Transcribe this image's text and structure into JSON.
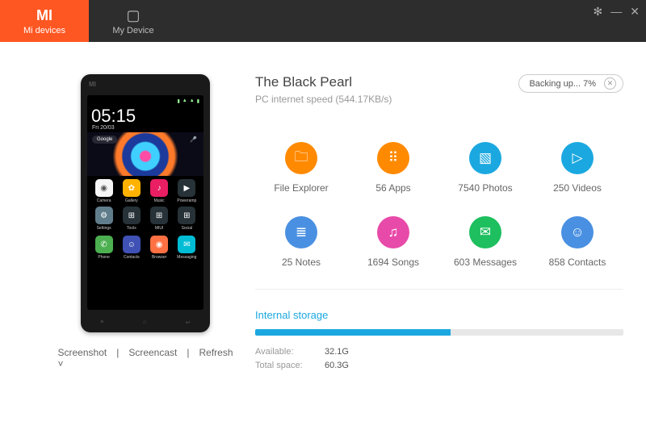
{
  "header": {
    "tabs": [
      {
        "label": "Mi devices",
        "icon": "MI"
      },
      {
        "label": "My Device",
        "icon": "▢"
      }
    ]
  },
  "phone": {
    "clock": "05:15",
    "date": "Fri 20/03",
    "search": "Google",
    "apps": [
      {
        "label": "Camera",
        "bg": "#f5f5f5",
        "glyph": "◉",
        "fg": "#555"
      },
      {
        "label": "Gallery",
        "bg": "#ffb300",
        "glyph": "✿"
      },
      {
        "label": "Music",
        "bg": "#e91e63",
        "glyph": "♪"
      },
      {
        "label": "Poweramp",
        "bg": "#263238",
        "glyph": "▶"
      },
      {
        "label": "Settings",
        "bg": "#607d8b",
        "glyph": "⚙"
      },
      {
        "label": "Tools",
        "bg": "#263238",
        "glyph": "⊞"
      },
      {
        "label": "MIUI",
        "bg": "#263238",
        "glyph": "⊞"
      },
      {
        "label": "Social",
        "bg": "#263238",
        "glyph": "⊞"
      }
    ],
    "dock": [
      {
        "label": "Phone",
        "bg": "#4caf50",
        "glyph": "✆"
      },
      {
        "label": "Contacts",
        "bg": "#3f51b5",
        "glyph": "☺"
      },
      {
        "label": "Browser",
        "bg": "#ff7043",
        "glyph": "◉"
      },
      {
        "label": "Messaging",
        "bg": "#00bcd4",
        "glyph": "✉"
      }
    ],
    "actions": {
      "screenshot": "Screenshot",
      "screencast": "Screencast",
      "refresh": "Refresh"
    }
  },
  "device": {
    "name": "The Black Pearl",
    "subtitle": "PC internet speed (544.17KB/s)",
    "backup": {
      "text": "Backing up... 7%"
    }
  },
  "tiles": [
    {
      "label": "File Explorer",
      "bg": "#ff8a00",
      "glyph": "🗀"
    },
    {
      "label": "56 Apps",
      "bg": "#ff8a00",
      "glyph": "⠿"
    },
    {
      "label": "7540 Photos",
      "bg": "#1ba8e0",
      "glyph": "▧"
    },
    {
      "label": "250 Videos",
      "bg": "#1ba8e0",
      "glyph": "▷"
    },
    {
      "label": "25 Notes",
      "bg": "#4a90e2",
      "glyph": "≣"
    },
    {
      "label": "1694 Songs",
      "bg": "#e84aa9",
      "glyph": "♫"
    },
    {
      "label": "603 Messages",
      "bg": "#1dbf5e",
      "glyph": "✉"
    },
    {
      "label": "858 Contacts",
      "bg": "#4a90e2",
      "glyph": "☺"
    }
  ],
  "storage": {
    "title": "Internal storage",
    "available_label": "Available:",
    "available_value": "32.1G",
    "total_label": "Total space:",
    "total_value": "60.3G",
    "fill_pct": 47
  }
}
